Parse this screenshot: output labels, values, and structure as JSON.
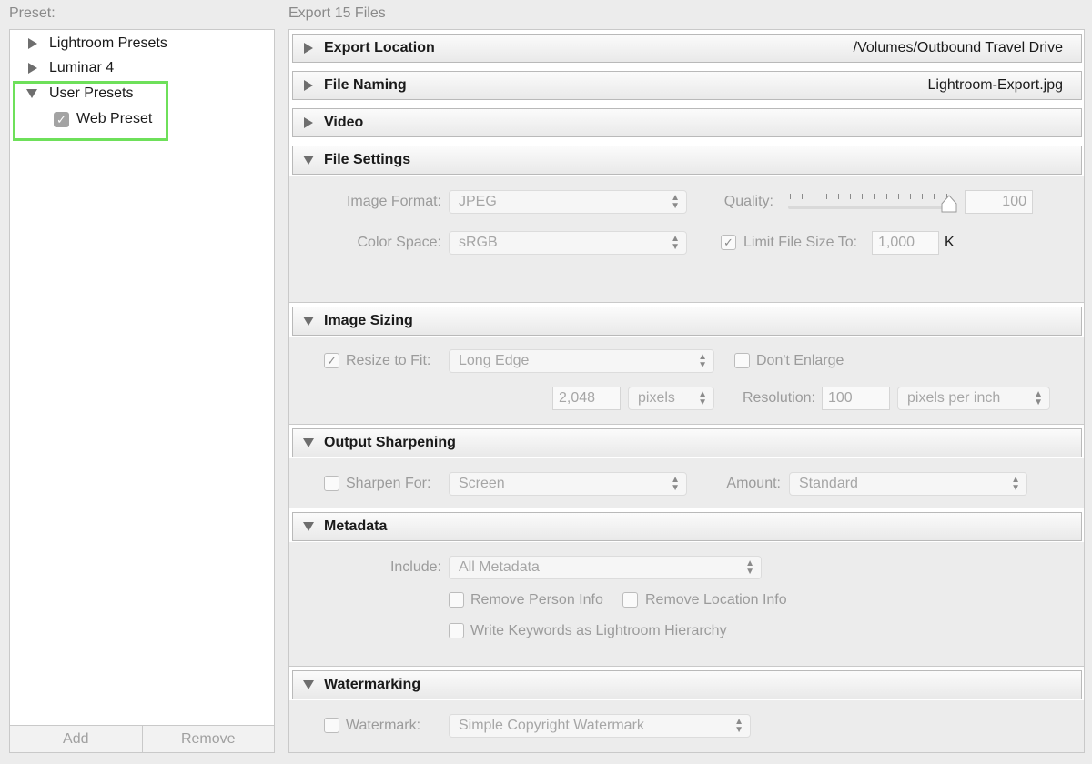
{
  "left": {
    "label": "Preset:",
    "tree": [
      {
        "label": "Lightroom Presets"
      },
      {
        "label": "Luminar 4"
      },
      {
        "label": "User Presets"
      },
      {
        "label": "Web Preset"
      }
    ],
    "add": "Add",
    "remove": "Remove"
  },
  "right": {
    "label": "Export 15 Files",
    "sections": {
      "export_location": {
        "title": "Export Location",
        "info": "/Volumes/Outbound Travel Drive"
      },
      "file_naming": {
        "title": "File Naming",
        "info": "Lightroom-Export.jpg"
      },
      "video": {
        "title": "Video"
      },
      "file_settings": {
        "title": "File Settings",
        "image_format_label": "Image Format:",
        "image_format": "JPEG",
        "quality_label": "Quality:",
        "quality": "100",
        "quality_value": 100,
        "color_space_label": "Color Space:",
        "color_space": "sRGB",
        "limit_label": "Limit File Size To:",
        "limit_value": "1,000",
        "limit_unit": "K"
      },
      "image_sizing": {
        "title": "Image Sizing",
        "resize_label": "Resize to Fit:",
        "resize_mode": "Long Edge",
        "dont_enlarge": "Don't Enlarge",
        "size_value": "2,048",
        "size_unit": "pixels",
        "resolution_label": "Resolution:",
        "resolution_value": "100",
        "resolution_unit": "pixels per inch"
      },
      "output_sharpening": {
        "title": "Output Sharpening",
        "sharpen_label": "Sharpen For:",
        "sharpen_for": "Screen",
        "amount_label": "Amount:",
        "amount": "Standard"
      },
      "metadata": {
        "title": "Metadata",
        "include_label": "Include:",
        "include": "All Metadata",
        "remove_person": "Remove Person Info",
        "remove_location": "Remove Location Info",
        "write_keywords": "Write Keywords as Lightroom Hierarchy"
      },
      "watermarking": {
        "title": "Watermarking",
        "watermark_label": "Watermark:",
        "watermark": "Simple Copyright Watermark"
      }
    }
  },
  "colors": {
    "highlight": "#6ee05a",
    "panel": "#ececec"
  }
}
